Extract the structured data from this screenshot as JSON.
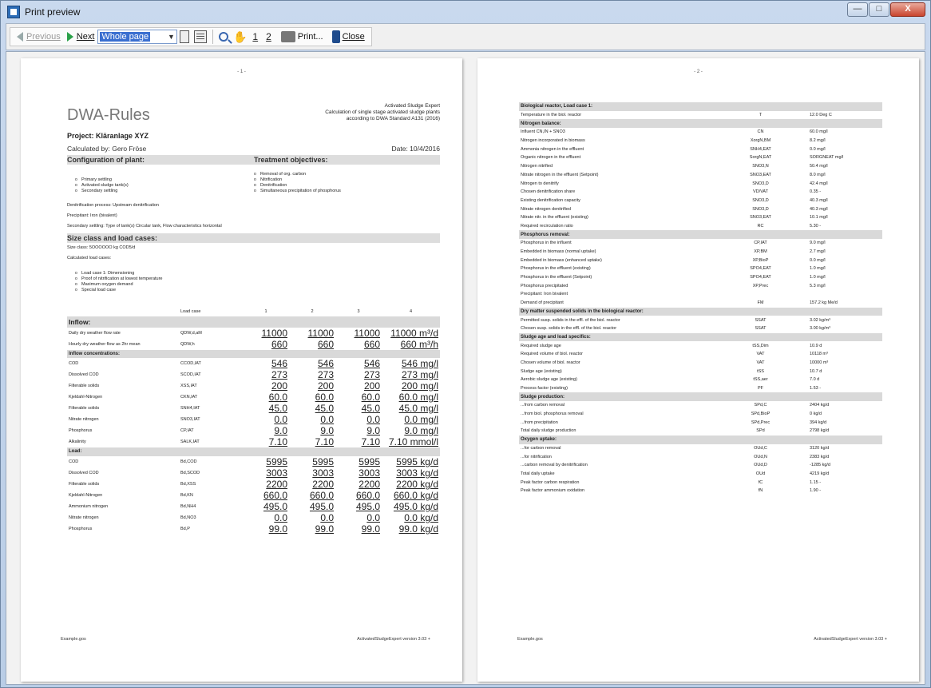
{
  "window": {
    "title": "Print preview",
    "min": "—",
    "max": "□",
    "close": "X"
  },
  "toolbar": {
    "previous": "Previous",
    "next": "Next",
    "zoom_value": "Whole page",
    "page1": "1",
    "page2": "2",
    "print": "Print...",
    "close": "Close"
  },
  "page1": {
    "number": "- 1 -",
    "brand": "DWA-Rules",
    "header_right": [
      "Activated Sludge Expert",
      "Calculation of single stage activated sludge plants",
      "according to DWA Standard A131 (2016)"
    ],
    "project": "Project: Kläranlage XYZ",
    "calculated_by": "Calculated by: Gero Fröse",
    "date": "Date: 10/4/2016",
    "section_config": "Configuration of plant:",
    "section_objectives": "Treatment objectives:",
    "config_items": [
      "Primary settling",
      "Activated sludge tank(s)",
      "Secondary settling"
    ],
    "objective_items": [
      "Removal of org. carbon",
      "Nitrification",
      "Denitrification",
      "Simultaneous precipitation of phosphorus"
    ],
    "denitrification": "Denitrification process: Upstream denitrification",
    "precipitant": "Precipitant: Iron (bivalent)",
    "secondary": "Secondary settling: Type of tank(s) Circular tank, Flow characteristics horizontal",
    "section_size": "Size class and load cases:",
    "size_class": "Size class: 5OOOOOO kg COD5/d",
    "calculated_load": "Calculated load cases:",
    "load_items": [
      "Load case 1: Dimensioning",
      "Proof of nitrification at lowest temperature",
      "Maximum oxygen demand",
      "Special load case"
    ],
    "load_header": [
      "Load case",
      "1",
      "2",
      "3",
      "4"
    ],
    "inflow_title": "Inflow:",
    "inflow_rows": [
      [
        "Daily dry weather flow rate",
        "QDW,d,aM",
        "11000",
        "11000",
        "11000",
        "11000 m³/d"
      ],
      [
        "Hourly dry weather flow as 2hr mean",
        "QDW,h",
        "660",
        "660",
        "660",
        "660 m³/h"
      ]
    ],
    "conc_title": "Inflow concentrations:",
    "conc_rows": [
      [
        "COD",
        "CCOD,IAT",
        "546",
        "546",
        "546",
        "546 mg/l"
      ],
      [
        "Dissolved COD",
        "SCOD,IAT",
        "273",
        "273",
        "273",
        "273 mg/l"
      ],
      [
        "Filterable solids",
        "XSS,IAT",
        "200",
        "200",
        "200",
        "200 mg/l"
      ],
      [
        "Kjeldahl-Nitrogen",
        "CKN,IAT",
        "60.0",
        "60.0",
        "60.0",
        "60.0 mg/l"
      ],
      [
        "Filterable solids",
        "SNH4,IAT",
        "45.0",
        "45.0",
        "45.0",
        "45.0 mg/l"
      ],
      [
        "Nitrate nitrogen",
        "SNO3,IAT",
        "0.0",
        "0.0",
        "0.0",
        "0.0 mg/l"
      ],
      [
        "Phosphorus",
        "CP,IAT",
        "9.0",
        "9.0",
        "9.0",
        "9.0 mg/l"
      ],
      [
        "Alkalinity",
        "SALK,IAT",
        "7.10",
        "7.10",
        "7.10",
        "7.10 mmol/l"
      ]
    ],
    "load_title": "Load:",
    "load_rows": [
      [
        "COD",
        "Bd,COD",
        "5995",
        "5995",
        "5995",
        "5995 kg/d"
      ],
      [
        "Dissolved COD",
        "Bd,SCOD",
        "3003",
        "3003",
        "3003",
        "3003 kg/d"
      ],
      [
        "Filterable solids",
        "Bd,XSS",
        "2200",
        "2200",
        "2200",
        "2200 kg/d"
      ],
      [
        "Kjeldahl-Nitrogen",
        "Bd,KN",
        "660.0",
        "660.0",
        "660.0",
        "660.0 kg/d"
      ],
      [
        "Ammonium nitrogen",
        "Bd,NH4",
        "495.0",
        "495.0",
        "495.0",
        "495.0 kg/d"
      ],
      [
        "Nitrate nitrogen",
        "Bd,NO3",
        "0.0",
        "0.0",
        "0.0",
        "0.0 kg/d"
      ],
      [
        "Phosphorus",
        "Bd,P",
        "99.0",
        "99.0",
        "99.0",
        "99.0 kg/d"
      ]
    ],
    "footer_left": "Example.gos",
    "footer_right": "ActivatedSludgeExpert version 3.03 +"
  },
  "page2": {
    "number": "- 2 -",
    "rows": [
      {
        "h": "Biological reactor, Load case 1:"
      },
      {
        "c": [
          "Temperature in the biol. reactor",
          "T",
          "12.0 Deg C"
        ]
      },
      {
        "h": "Nitrogen balance:"
      },
      {
        "c": [
          "Influent CN,IN + SNO3",
          "CN",
          "60.0 mg/l"
        ]
      },
      {
        "c": [
          "Nitrogen incorporated in biomass",
          "XorgN,BM",
          "8.2 mg/l"
        ]
      },
      {
        "c": [
          "Ammonia nitrogen in the effluent",
          "SNH4,EAT",
          "0.0 mg/l"
        ]
      },
      {
        "c": [
          "Organic nitrogen in the effluent",
          "SorgN,EAT",
          "SORGNEAT mg/l"
        ]
      },
      {
        "c": [
          "Nitrogen nitrified",
          "SNO3,N",
          "50.4 mg/l"
        ]
      },
      {
        "c": [
          "Nitrate nitrogen in the effluent (Setpoint)",
          "SNO3,EAT",
          "8.0 mg/l"
        ]
      },
      {
        "c": [
          "Nitrogen to denitrify",
          "SNO3,D",
          "42.4 mg/l"
        ]
      },
      {
        "c": [
          "Chosen denitrification share",
          "VD/VAT",
          "0.35 -"
        ]
      },
      {
        "c": [
          "Existing denitrification capacity",
          "SNO3,D",
          "40.3 mg/l"
        ]
      },
      {
        "c": [
          "Nitrate nitrogen denitrified",
          "SNO3,D",
          "40.3 mg/l"
        ]
      },
      {
        "c": [
          "Nitrate nitr. in the effluent (existing)",
          "SNO3,EAT",
          "10.1 mg/l"
        ]
      },
      {
        "c": [
          "Required recirculation ratio",
          "RC",
          "5.30 -"
        ]
      },
      {
        "h": "Phosphorus removal:"
      },
      {
        "c": [
          "Phosphorus in the influent",
          "CP,IAT",
          "9.0 mg/l"
        ]
      },
      {
        "c": [
          "Embedded in biomass (normal uptake)",
          "XP,BM",
          "2.7 mg/l"
        ]
      },
      {
        "c": [
          "Embedded in biomass (enhanced uptake)",
          "XP,BioP",
          "0.0 mg/l"
        ]
      },
      {
        "c": [
          "Phosphorus in the effluent (existing)",
          "SPO4,EAT",
          "1.0 mg/l"
        ]
      },
      {
        "c": [
          "Phosphorus in the effluent (Setpoint)",
          "SPO4,EAT",
          "1.0 mg/l"
        ]
      },
      {
        "c": [
          "Phosphorus precipitated",
          "XP,Prec",
          "5.3 mg/l"
        ]
      },
      {
        "c": [
          "Precipitant: Iron bivalent",
          "",
          ""
        ]
      },
      {
        "c": [
          "Demand of precipitant",
          "FM",
          "157.2 kg Me/d"
        ]
      },
      {
        "h": "Dry matter suspended solids in the biological reactor:"
      },
      {
        "c": [
          "Permitted susp. solids in the effl. of the biol. reactor",
          "SSAT",
          "3.02 kg/m³"
        ]
      },
      {
        "c": [
          "Chosen susp. solids in the effl. of the biol. reactor",
          "SSAT",
          "3.00 kg/m³"
        ]
      },
      {
        "h": "Sludge age and load specifics:"
      },
      {
        "c": [
          "Required sludge age",
          "tSS,Dim",
          "10.9 d"
        ]
      },
      {
        "c": [
          "Required volume of biol. reactor",
          "VAT",
          "10118 m³"
        ]
      },
      {
        "c": [
          "Chosen volume of biol. reactor",
          "VAT",
          "10000 m³"
        ]
      },
      {
        "c": [
          "Sludge age (existing)",
          "tSS",
          "10.7 d"
        ]
      },
      {
        "c": [
          "Aerobic sludge age (existing)",
          "tSS,aer",
          "7.0 d"
        ]
      },
      {
        "c": [
          "Process factor (existing)",
          "PF",
          "1.53 -"
        ]
      },
      {
        "h": "Sludge production:"
      },
      {
        "c": [
          "...from carbon removal",
          "SPd,C",
          "2404 kg/d"
        ]
      },
      {
        "c": [
          "...from biol. phosphorus removal",
          "SPd,BioP",
          "0 kg/d"
        ]
      },
      {
        "c": [
          "...from precipitation",
          "SPd,Prec",
          "394 kg/d"
        ]
      },
      {
        "c": [
          "Total daily sludge production",
          "SPd",
          "2798 kg/d"
        ]
      },
      {
        "h": "Oxygen uptake:"
      },
      {
        "c": [
          "...for carbon removal",
          "OUd,C",
          "3120 kg/d"
        ]
      },
      {
        "c": [
          "...for nitrification",
          "OUd,N",
          "2383 kg/d"
        ]
      },
      {
        "c": [
          "...carbon removal by denitrification",
          "OUd,D",
          "-1285 kg/d"
        ]
      },
      {
        "c": [
          "Total daily uptake",
          "OUd",
          "4219 kg/d"
        ]
      },
      {
        "c": [
          "Peak factor carbon respiration",
          "fC",
          "1.15 -"
        ]
      },
      {
        "c": [
          "Peak factor ammonium oxidation",
          "fN",
          "1.90 -"
        ]
      }
    ],
    "footer_left": "Example.gos",
    "footer_right": "ActivatedSludgeExpert version 3.03 +"
  }
}
